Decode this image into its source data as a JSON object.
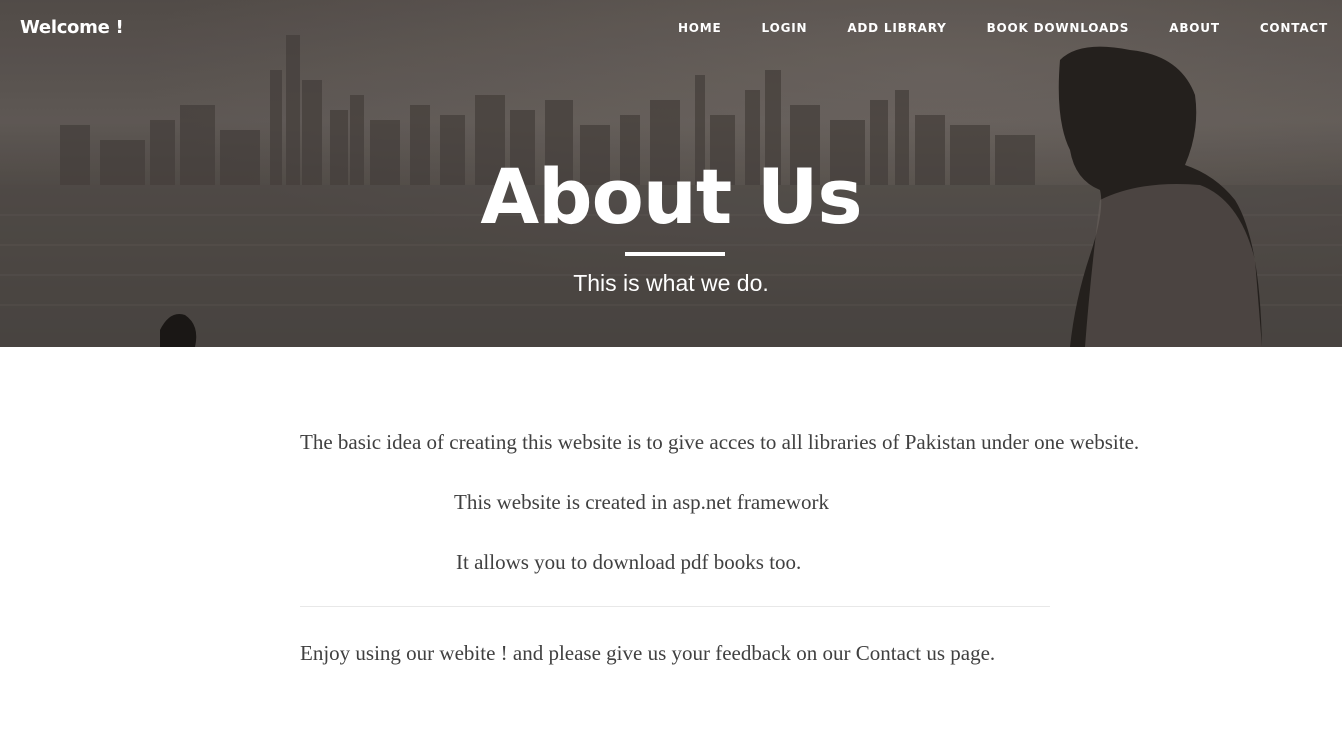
{
  "navbar": {
    "brand": "Welcome !",
    "links": [
      "HOME",
      "LOGIN",
      "ADD LIBRARY",
      "BOOK DOWNLOADS",
      "ABOUT",
      "CONTACT"
    ]
  },
  "hero": {
    "title": "About Us",
    "subtitle": "This is what we do."
  },
  "content": {
    "paragraph_1": "The basic idea of creating this website is to give acces to all libraries of Pakistan under one website.",
    "paragraph_2": "This website is created in asp.net framework",
    "paragraph_3": "It allows you to download pdf books too.",
    "paragraph_4": "Enjoy using our webite ! and please give us your feedback on our Contact us page."
  },
  "colors": {
    "text_body": "#404040",
    "hero_text": "#ffffff",
    "divider": "#e8e8e8"
  }
}
